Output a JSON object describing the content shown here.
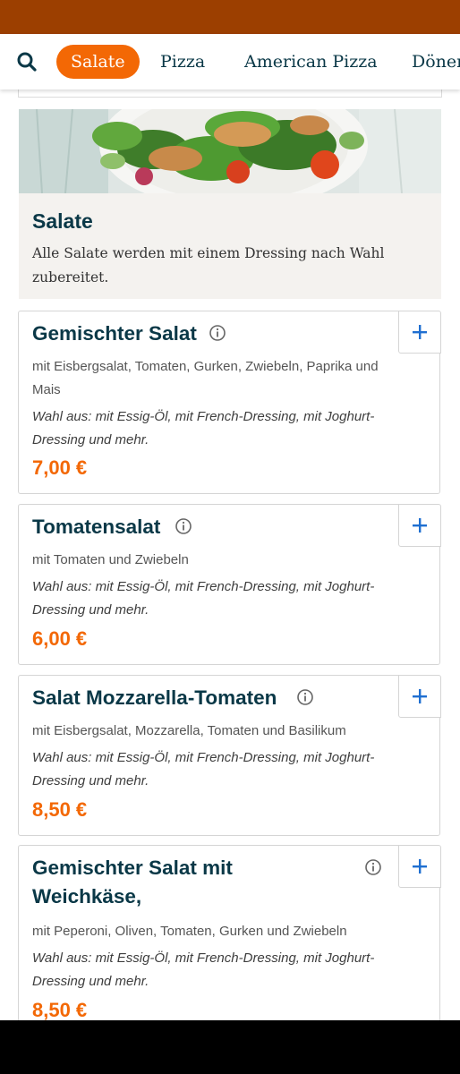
{
  "nav": {
    "tabs": [
      {
        "label": "Salate",
        "active": true
      },
      {
        "label": "Pizza",
        "active": false
      },
      {
        "label": "American Pizza",
        "active": false
      },
      {
        "label": "Döner",
        "active": false
      }
    ]
  },
  "category": {
    "title": "Salate",
    "description": "Alle Salate werden mit einem Dressing nach Wahl zubereitet."
  },
  "products": [
    {
      "name": "Gemischter Salat",
      "description": "mit Eisbergsalat, Tomaten, Gurken, Zwiebeln, Paprika und Mais",
      "choice": "Wahl aus: mit Essig-Öl, mit French-Dressing, mit Joghurt-Dressing und mehr.",
      "price": "7,00 €"
    },
    {
      "name": "Tomatensalat",
      "description": "mit Tomaten und Zwiebeln",
      "choice": "Wahl aus: mit Essig-Öl, mit French-Dressing, mit Joghurt-Dressing und mehr.",
      "price": "6,00 €"
    },
    {
      "name": "Salat Mozzarella-Tomaten",
      "description": "mit Eisbergsalat, Mozzarella, Tomaten und Basilikum",
      "choice": "Wahl aus: mit Essig-Öl, mit French-Dressing, mit Joghurt-Dressing und mehr.",
      "price": "8,50 €"
    },
    {
      "name": "Gemischter Salat mit Weichkäse,",
      "description": "mit Peperoni, Oliven, Tomaten, Gurken und Zwiebeln",
      "choice": "Wahl aus: mit Essig-Öl, mit French-Dressing, mit Joghurt-Dressing und mehr.",
      "price": "8,50 €"
    }
  ],
  "icons": {
    "search": "search-icon",
    "info": "info-icon",
    "add": "plus-icon"
  },
  "colors": {
    "accent": "#f36805",
    "status_bar": "#9c3f00",
    "text_dark": "#0a3847",
    "add_icon": "#1f6fd1"
  }
}
